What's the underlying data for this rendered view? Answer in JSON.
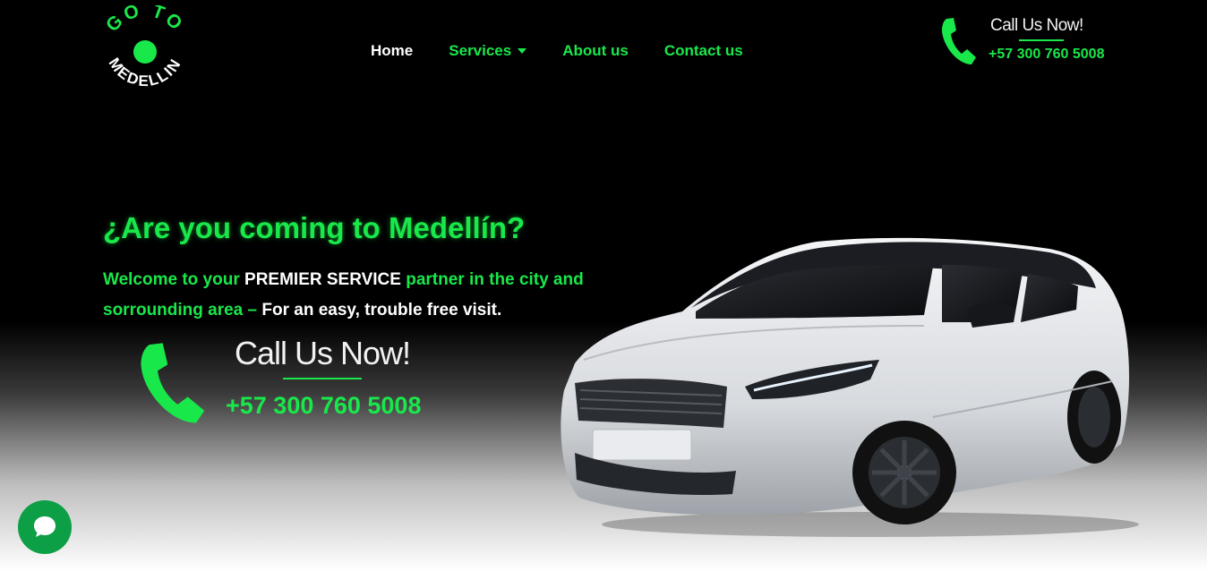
{
  "brand": {
    "logo_top": "GO TO",
    "logo_bottom": "MEDELLIN",
    "accent": "#19e84a"
  },
  "nav": {
    "items": [
      {
        "label": "Home",
        "active": true
      },
      {
        "label": "Services",
        "has_dropdown": true
      },
      {
        "label": "About us"
      },
      {
        "label": "Contact us"
      }
    ]
  },
  "header_call": {
    "label": "Call Us Now!",
    "number": "+57 300 760 5008",
    "icon": "phone-icon"
  },
  "hero": {
    "title": "¿Are you coming to Medellín?",
    "text_1": "Welcome to your ",
    "text_2": "PREMIER SERVICE",
    "text_3": " partner in the city and sorrounding area – ",
    "text_4": "For an easy, trouble free visit.",
    "call_label": "Call Us Now!",
    "call_number": "+57 300 760 5008",
    "car_image": "car-image"
  },
  "chat": {
    "icon": "chat-bubble-icon"
  }
}
